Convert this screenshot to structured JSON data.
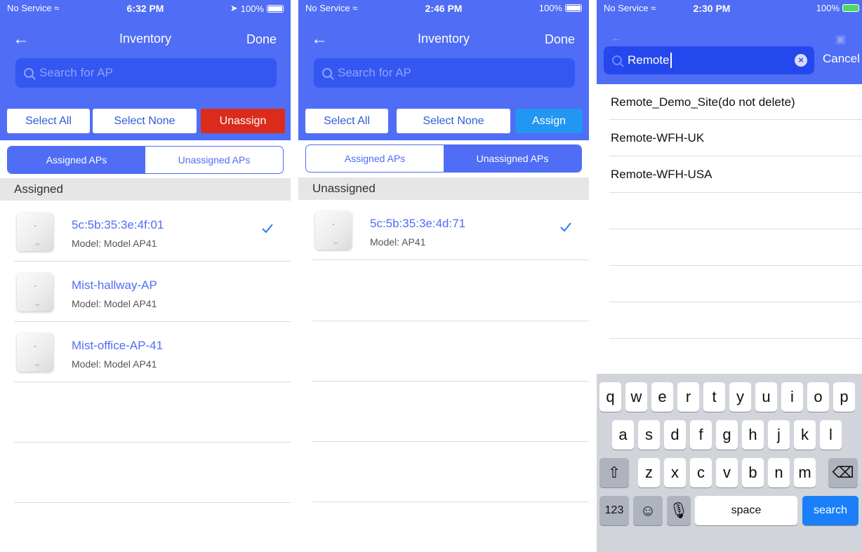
{
  "screens": [
    {
      "status": {
        "carrier": "No Service",
        "time": "6:32 PM",
        "battery": "100%"
      },
      "nav": {
        "title": "Inventory",
        "done": "Done"
      },
      "search_placeholder": "Search for AP",
      "buttons": {
        "select_all": "Select All",
        "select_none": "Select None",
        "action": "Unassign"
      },
      "tabs": {
        "assigned": "Assigned APs",
        "unassigned": "Unassigned APs",
        "active": "assigned"
      },
      "section": "Assigned",
      "items": [
        {
          "name": "5c:5b:35:3e:4f:01",
          "model": "Model: Model AP41",
          "checked": true
        },
        {
          "name": "Mist-hallway-AP",
          "model": "Model: Model AP41",
          "checked": false
        },
        {
          "name": "Mist-office-AP-41",
          "model": "Model: Model AP41",
          "checked": false
        }
      ]
    },
    {
      "status": {
        "carrier": "No Service",
        "time": "2:46 PM",
        "battery": "100%"
      },
      "nav": {
        "title": "Inventory",
        "done": "Done"
      },
      "search_placeholder": "Search for AP",
      "buttons": {
        "select_all": "Select All",
        "select_none": "Select None",
        "action": "Assign"
      },
      "tabs": {
        "assigned": "Assigned APs",
        "unassigned": "Unassigned APs",
        "active": "unassigned"
      },
      "section": "Unassigned",
      "items": [
        {
          "name": "5c:5b:35:3e:4d:71",
          "model": "Model: AP41",
          "checked": true
        }
      ]
    },
    {
      "status": {
        "carrier": "No Service",
        "time": "2:30 PM",
        "battery": "100%"
      },
      "search": {
        "value": "Remote",
        "cancel": "Cancel"
      },
      "results": [
        "Remote_Demo_Site(do not delete)",
        "Remote-WFH-UK",
        "Remote-WFH-USA"
      ],
      "keyboard": {
        "row1": [
          "q",
          "w",
          "e",
          "r",
          "t",
          "y",
          "u",
          "i",
          "o",
          "p"
        ],
        "row2": [
          "a",
          "s",
          "d",
          "f",
          "g",
          "h",
          "j",
          "k",
          "l"
        ],
        "row3": [
          "z",
          "x",
          "c",
          "v",
          "b",
          "n",
          "m"
        ],
        "numbers": "123",
        "space": "space",
        "search": "search"
      }
    }
  ],
  "colors": {
    "brand": "#4f6df5",
    "danger": "#db2b1b",
    "accent": "#2196f3"
  }
}
